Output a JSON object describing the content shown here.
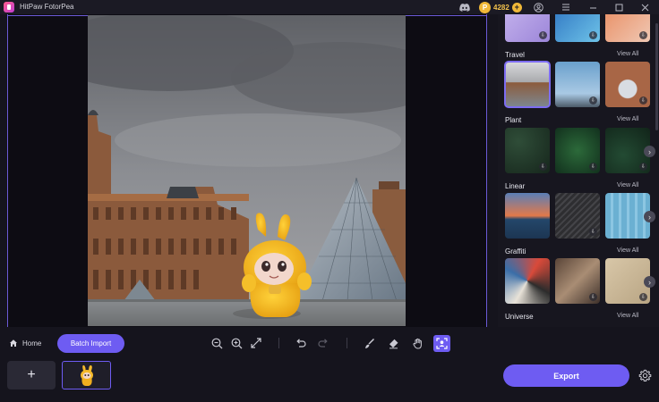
{
  "window": {
    "title": "HitPaw FotorPea",
    "coins": "4282"
  },
  "icons": {
    "app_logo": "hitpaw-logo-icon",
    "discord": "discord-icon",
    "coin": "coin-icon",
    "add_coins": "plus-circle-icon",
    "account": "user-icon",
    "menu": "hamburger-menu-icon",
    "minimize": "minimize-icon",
    "maximize": "maximize-icon",
    "close": "close-icon"
  },
  "templates": {
    "view_all": "View All",
    "categories": [
      {
        "label": "Travel",
        "colors": [
          "#8c7a76",
          "#6aa0cc",
          "#a86646"
        ]
      },
      {
        "label": "Plant",
        "colors": [
          "#1e3326",
          "#1d4a2a",
          "#1a3a27"
        ]
      },
      {
        "label": "Linear",
        "colors": [
          "#e2794a",
          "#3b3b3e",
          "#7ab8d6"
        ]
      },
      {
        "label": "Graffiti",
        "colors": [
          "#b7b0a6",
          "#7b6554",
          "#c9b99d"
        ]
      },
      {
        "label": "Universe",
        "colors": []
      }
    ]
  },
  "toolbar": {
    "home_label": "Home",
    "batch_import_label": "Batch Import",
    "export_label": "Export",
    "add_label": "+"
  },
  "colors": {
    "accent": "#6e5cf2",
    "background": "#15141d",
    "coin": "#f0b838"
  }
}
